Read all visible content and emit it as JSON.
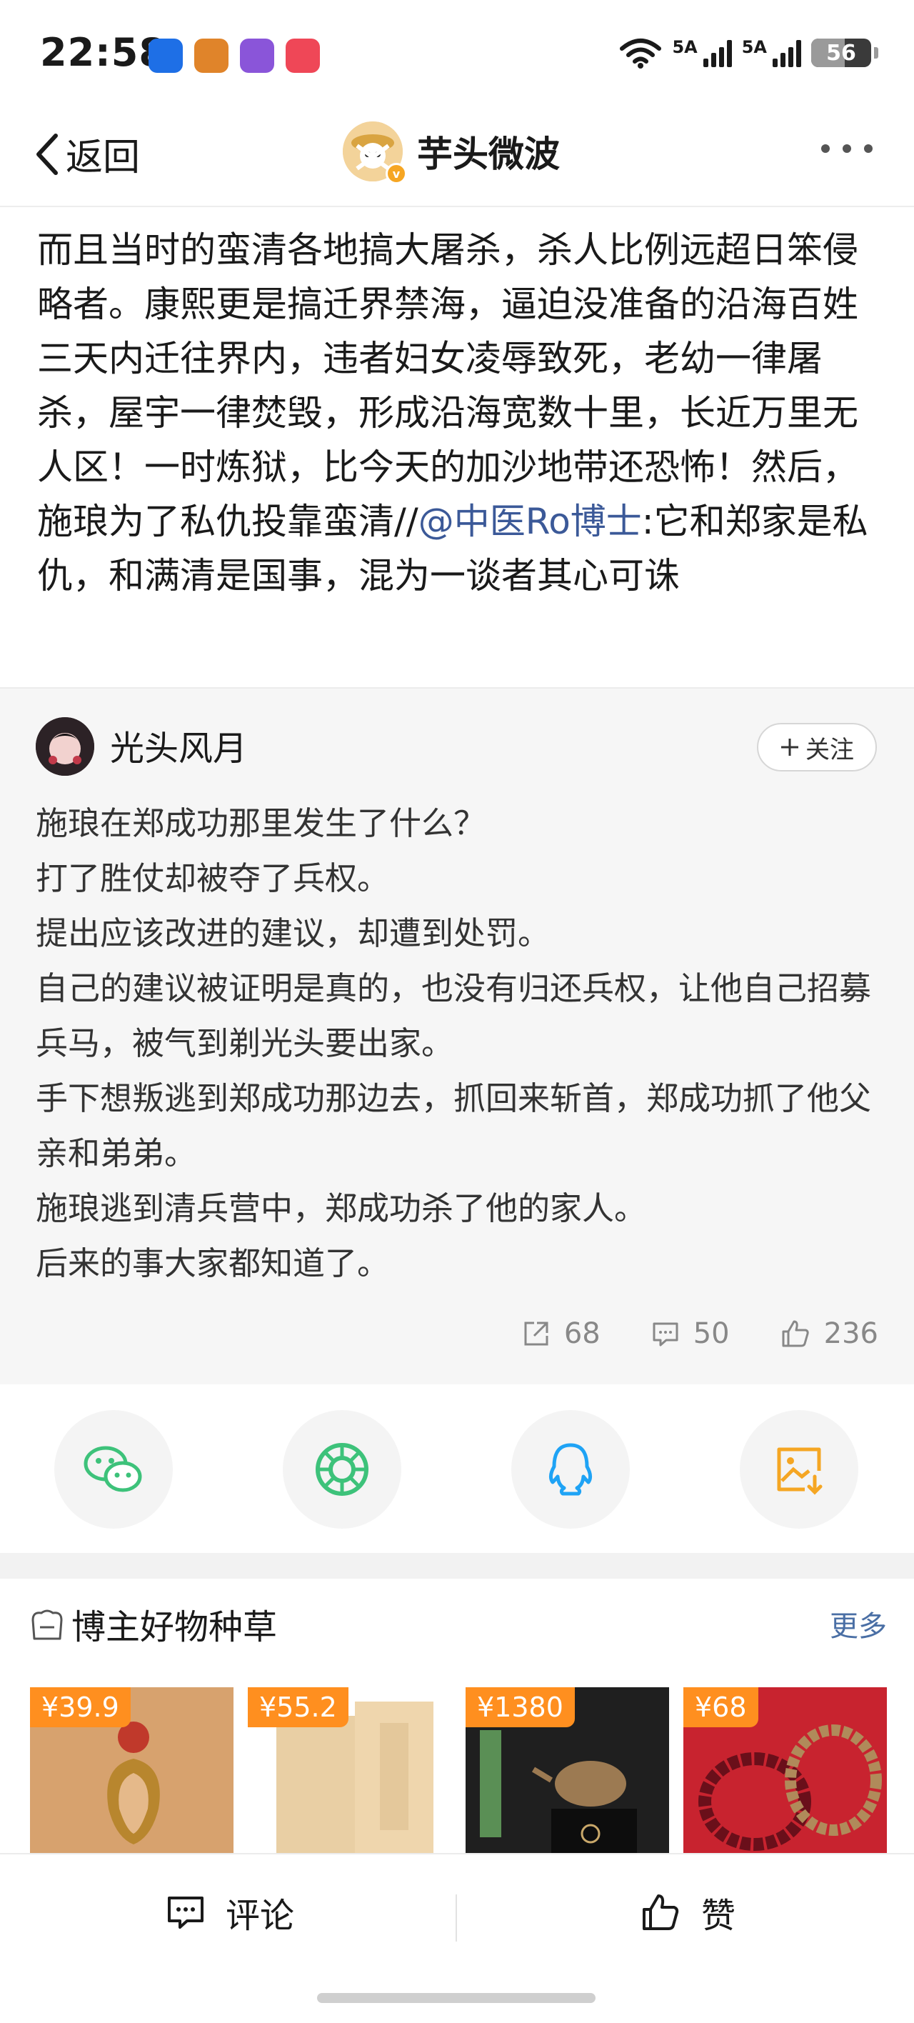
{
  "status_bar": {
    "time": "22:58",
    "signal1_label": "5A",
    "signal2_label": "5A",
    "battery": "56",
    "battery_level_percent": 56
  },
  "nav": {
    "back_label": "返回",
    "title": "芋头微波"
  },
  "repost": {
    "text": "而且当时的蛮清各地搞大屠杀，杀人比例远超日笨侵略者。康熙更是搞迁界禁海，逼迫没准备的沿海百姓三天内迁往界内，违者妇女凌辱致死，老幼一律屠杀，屋宇一律焚毁，形成沿海宽数十里，长近万里无人区！一时炼狱，比今天的加沙地带还恐怖！然后，施琅为了私仇投靠蛮清//",
    "mention": "@中医Ro博士",
    "text_after": ":它和郑家是私仇，和满清是国事，混为一谈者其心可诛"
  },
  "original": {
    "author": "光头风月",
    "follow_label": "关注",
    "lines": [
      "施琅在郑成功那里发生了什么？",
      "打了胜仗却被夺了兵权。",
      "提出应该改进的建议，却遭到处罚。",
      "自己的建议被证明是真的，也没有归还兵权，让他自己招募兵马，被气到剃光头要出家。",
      "手下想叛逃到郑成功那边去，抓回来斩首，郑成功抓了他父亲和弟弟。",
      "施琅逃到清兵营中，郑成功杀了他的家人。",
      "后来的事大家都知道了。"
    ],
    "reposts": "68",
    "comments": "50",
    "likes": "236"
  },
  "share": {
    "items": [
      "wechat-icon",
      "moments-icon",
      "qq-icon",
      "save-image-icon"
    ],
    "colors": {
      "wechat": "#3dc27a",
      "moments": "#3dc27a",
      "qq": "#1fa3f5",
      "save": "#f5a623"
    }
  },
  "recommend": {
    "title": "博主好物种草",
    "more_label": "更多",
    "products": [
      {
        "price": "¥39.9"
      },
      {
        "price": "¥55.2"
      },
      {
        "price": "¥1380"
      },
      {
        "price": "¥68"
      }
    ]
  },
  "bottom_bar": {
    "comment_label": "评论",
    "like_label": "赞"
  }
}
